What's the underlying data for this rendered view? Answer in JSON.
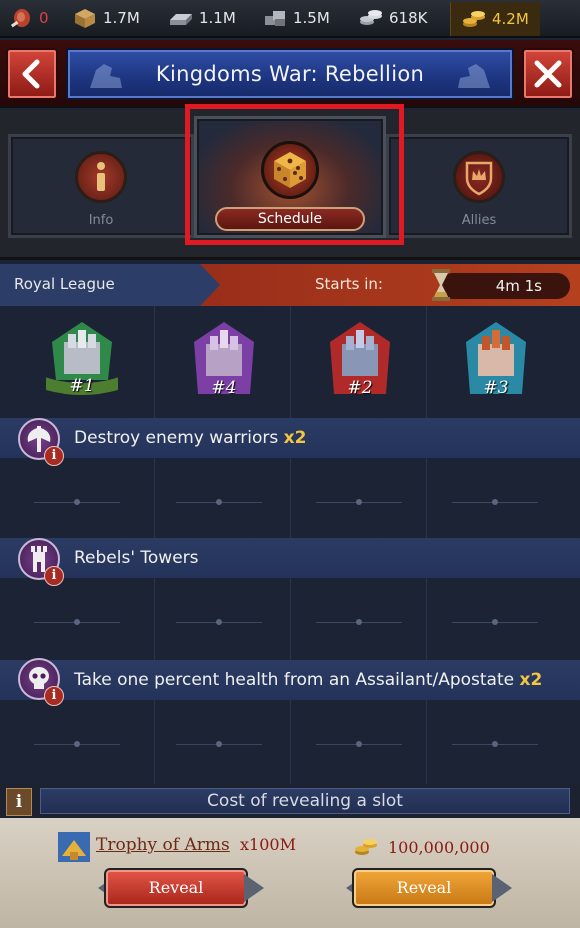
{
  "resources": {
    "food": "0",
    "wood": "1.7M",
    "iron": "1.1M",
    "stone": "1.5M",
    "silver": "618K",
    "gold": "4.2M"
  },
  "header": {
    "title": "Kingdoms War: Rebellion"
  },
  "tabs": [
    {
      "label": "Info"
    },
    {
      "label": "Schedule"
    },
    {
      "label": "Allies"
    }
  ],
  "league": {
    "name": "Royal League",
    "starts_label": "Starts in:",
    "timer": "4m  1s"
  },
  "castles": [
    {
      "rank": "#1",
      "color": "#2f8a4a"
    },
    {
      "rank": "#4",
      "color": "#7b3fa6"
    },
    {
      "rank": "#2",
      "color": "#b02a2a"
    },
    {
      "rank": "#3",
      "color": "#2a8aa6"
    }
  ],
  "tasks": [
    {
      "text": "Destroy enemy warriors",
      "multiplier": "x2",
      "icon": "axe-icon"
    },
    {
      "text": "Rebels' Towers",
      "multiplier": "",
      "icon": "tower-icon"
    },
    {
      "text": "Take one percent health from an Assailant/Apostate",
      "multiplier": "x2",
      "icon": "skull-icon"
    }
  ],
  "cost": {
    "title": "Cost of revealing a slot",
    "info": "i",
    "item_name": "Trophy of Arms",
    "item_qty": "x100M",
    "gold_cost": "100,000,000",
    "reveal_label_1": "Reveal",
    "reveal_label_2": "Reveal"
  },
  "task_info_mark": "i"
}
